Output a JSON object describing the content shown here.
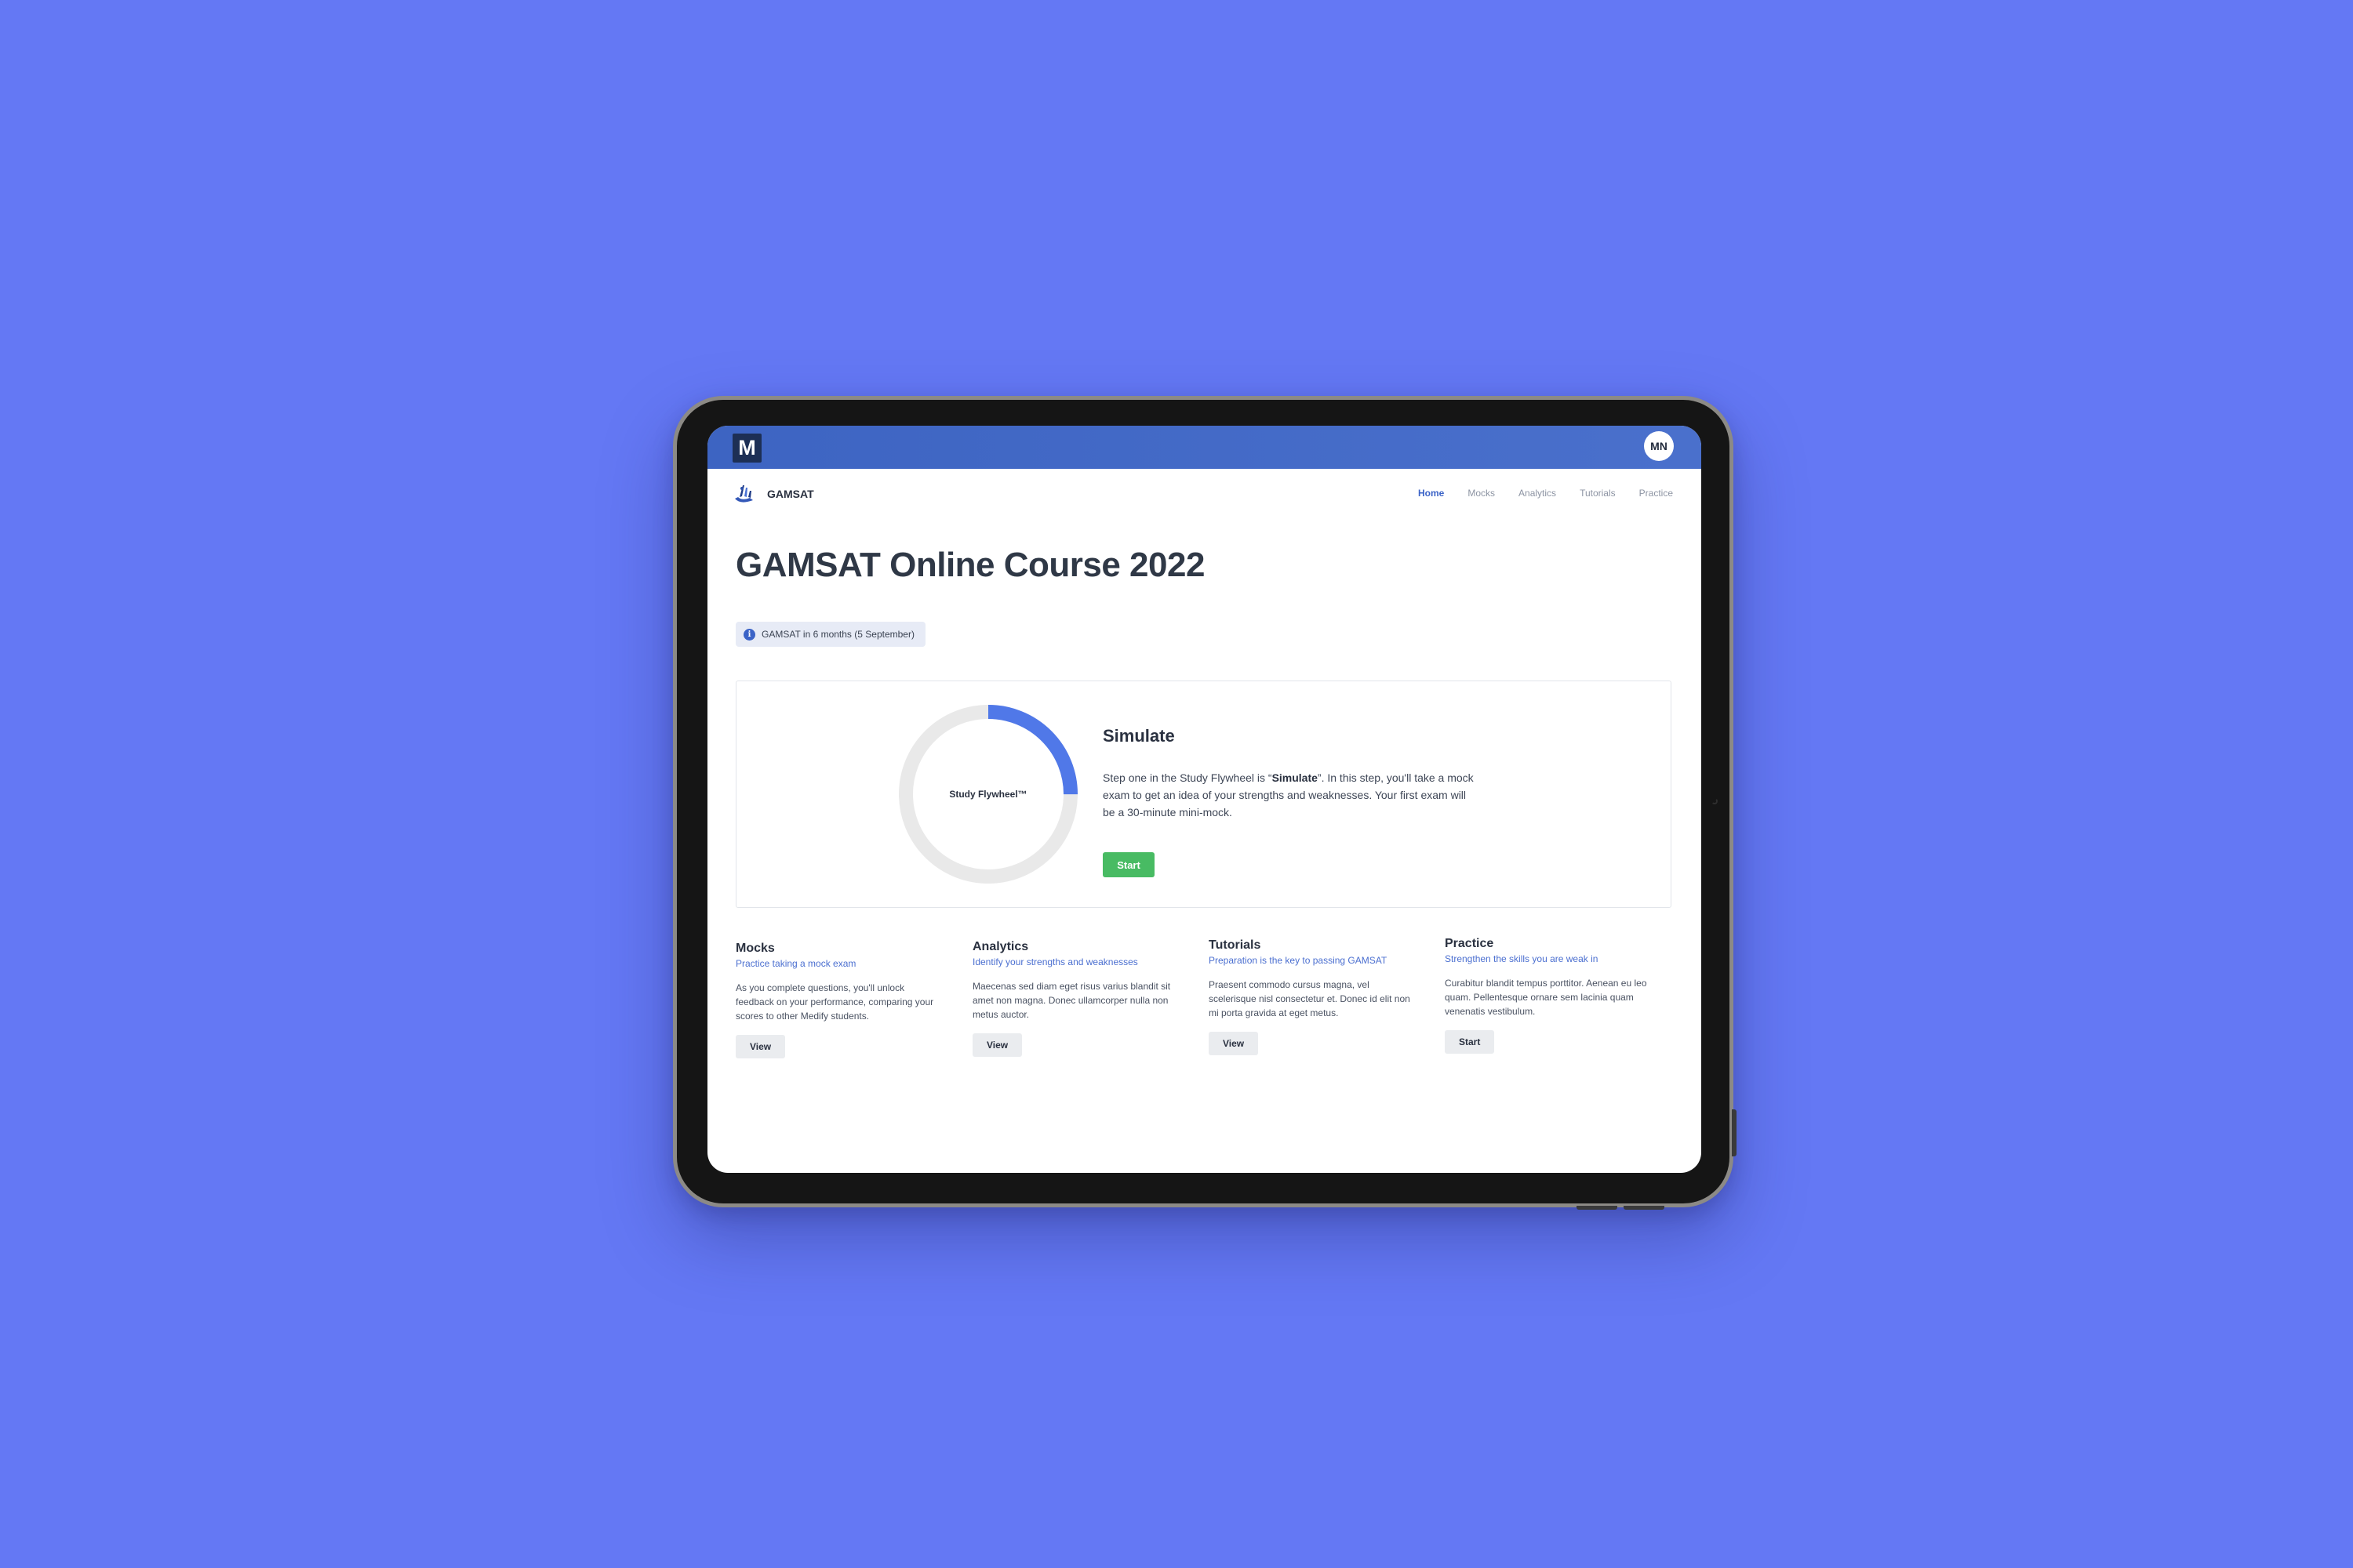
{
  "app": {
    "logo_letter": "M",
    "avatar_initials": "MN"
  },
  "brand": {
    "name": "GAMSAT"
  },
  "nav": {
    "items": [
      "Home",
      "Mocks",
      "Analytics",
      "Tutorials",
      "Practice"
    ],
    "active": "Home"
  },
  "page": {
    "title": "GAMSAT Online Course 2022",
    "exam_notice": "GAMSAT in 6 months (5 September)"
  },
  "flywheel": {
    "label": "Study Flywheel™",
    "progress_fraction": 0.25,
    "step_title": "Simulate",
    "desc_part1": "Step one in the Study Flywheel is “",
    "desc_bold": "Simulate",
    "desc_part2": "”.  In this step, you'll take a mock exam to get an idea of your strengths and weaknesses. Your first exam will be a 30-minute mini-mock.",
    "button_label": "Start",
    "accent_color": "#5078e8",
    "track_color": "#e9e9e9",
    "button_color": "#48bb63"
  },
  "features": [
    {
      "title": "Mocks",
      "subtitle": "Practice taking a mock exam",
      "desc": "As you complete questions, you'll unlock feedback on your performance, comparing your scores to other Medify students.",
      "button": "View"
    },
    {
      "title": "Analytics",
      "subtitle": "Identify your strengths and weaknesses",
      "desc": "Maecenas sed diam eget risus varius blandit sit amet non magna. Donec ullamcorper nulla non metus auctor.",
      "button": "View"
    },
    {
      "title": "Tutorials",
      "subtitle": "Preparation is the key to passing GAMSAT",
      "desc": "Praesent commodo cursus magna, vel scelerisque nisl consectetur et. Donec id elit non mi porta gravida at eget metus.",
      "button": "View"
    },
    {
      "title": "Practice",
      "subtitle": "Strengthen the skills you are weak in",
      "desc": "Curabitur blandit tempus porttitor. Aenean eu leo quam. Pellentesque ornare sem lacinia quam venenatis vestibulum.",
      "button": "Start"
    }
  ],
  "colors": {
    "background": "#6478f4",
    "appbar": "#4169c6",
    "link": "#4b6fd0"
  }
}
